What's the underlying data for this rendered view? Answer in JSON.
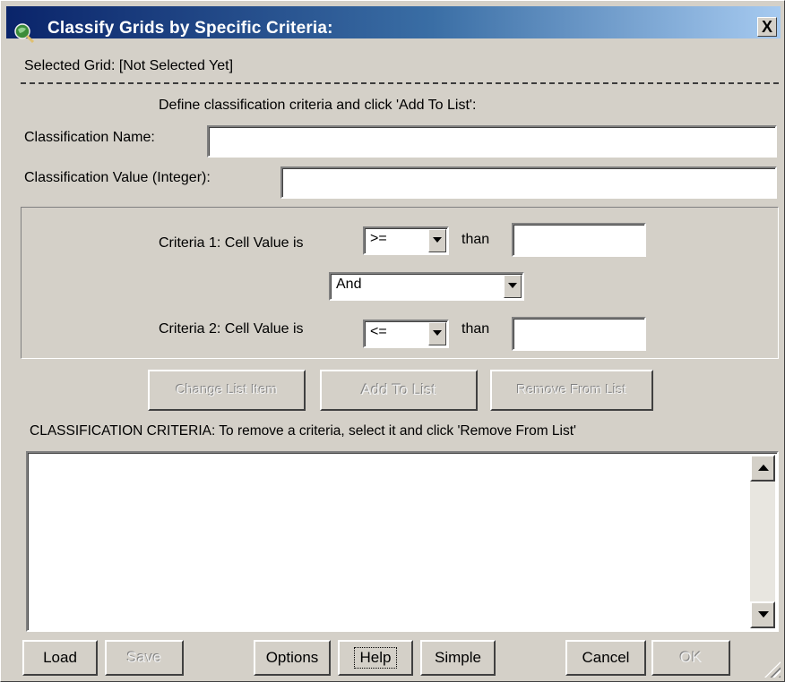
{
  "window": {
    "title": "Classify Grids by Specific Criteria:",
    "close_label": "X"
  },
  "selected_grid": "Selected Grid: [Not Selected Yet]",
  "instructions": "Define classification criteria and click 'Add To List':",
  "classification_name": {
    "label": "Classification Name:",
    "value": ""
  },
  "classification_value": {
    "label": "Classification Value (Integer):",
    "value": ""
  },
  "criteria1": {
    "label": "Criteria 1:  Cell Value is",
    "operator": ">=",
    "than_label": "than",
    "value": ""
  },
  "connector": {
    "value": "And"
  },
  "criteria2": {
    "label": "Criteria 2:  Cell Value is",
    "operator": "<=",
    "than_label": "than",
    "value": ""
  },
  "list_buttons": {
    "change": "Change List Item",
    "add": "Add To List",
    "remove": "Remove From List"
  },
  "list_header": "CLASSIFICATION CRITERIA:  To remove a criteria, select it and click 'Remove From List'",
  "criteria_list": [],
  "bottom_buttons": {
    "load": "Load",
    "save": "Save",
    "options": "Options",
    "help": "Help",
    "simple": "Simple",
    "cancel": "Cancel",
    "ok": "OK"
  },
  "icons": {
    "app": "globe-magnifier-icon",
    "close": "close-icon",
    "scroll_up": "arrow-up-icon",
    "scroll_down": "arrow-down-icon",
    "dropdown": "chevron-down-icon",
    "resize": "resize-grip-icon"
  },
  "colors": {
    "titlebar_start": "#0a246a",
    "titlebar_end": "#a6caf0",
    "window_face": "#d4d0c8"
  }
}
